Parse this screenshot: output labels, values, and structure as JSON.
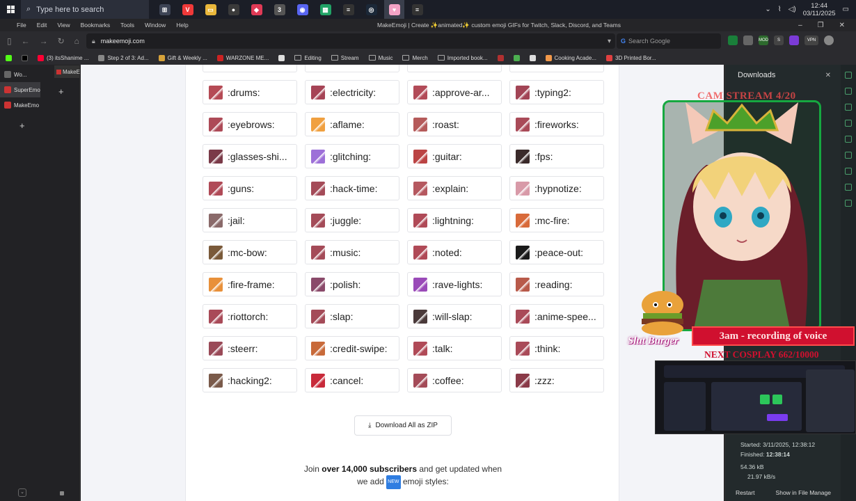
{
  "taskbar": {
    "search_placeholder": "Type here to search",
    "clock_time": "12:44",
    "clock_date": "03/11/2025",
    "apps": [
      {
        "icon": "widgets-icon",
        "color": "#3d4455",
        "glyph": "⊞"
      },
      {
        "icon": "vivaldi-icon",
        "color": "#ef3939",
        "glyph": "V"
      },
      {
        "icon": "folder-icon",
        "color": "#e9b73b",
        "glyph": "▭"
      },
      {
        "icon": "obs-icon",
        "color": "#3a3a3a",
        "glyph": "●"
      },
      {
        "icon": "maps-pin-icon",
        "color": "#e03a56",
        "glyph": "◆"
      },
      {
        "icon": "app3-icon",
        "color": "#555",
        "glyph": "3"
      },
      {
        "icon": "discord-icon",
        "color": "#5865f2",
        "glyph": "◉"
      },
      {
        "icon": "sheets-icon",
        "color": "#21a366",
        "glyph": "▦"
      },
      {
        "icon": "streamdeck-icon",
        "color": "#333",
        "glyph": "≡"
      },
      {
        "icon": "steam-icon",
        "color": "#1b2838",
        "glyph": "◎"
      },
      {
        "icon": "heart-app-icon",
        "color": "#f4a3c6",
        "glyph": "♥"
      },
      {
        "icon": "streamdeck2-icon",
        "color": "#333",
        "glyph": "≡"
      }
    ]
  },
  "browser": {
    "menu": [
      "File",
      "Edit",
      "View",
      "Bookmarks",
      "Tools",
      "Window",
      "Help"
    ],
    "title": "MakeEmoji | Create ✨animated✨ custom emoji GIFs for Twitch, Slack, Discord, and Teams",
    "url": "makeemoji.com",
    "search_placeholder": "Search Google",
    "bookmarks": [
      {
        "label": "(3) itsShanime ...",
        "color": "#ff0033"
      },
      {
        "label": "Step 2 of 3: Ad...",
        "color": "#888"
      },
      {
        "label": "Gift & Weekly ...",
        "color": "#d6a23a"
      },
      {
        "label": "WARZONE ME...",
        "color": "#c22"
      },
      {
        "label": "",
        "color": "#ddd"
      },
      {
        "label": "Editing",
        "color": "folder"
      },
      {
        "label": "Stream",
        "color": "folder"
      },
      {
        "label": "Music",
        "color": "folder"
      },
      {
        "label": "Merch",
        "color": "folder"
      },
      {
        "label": "Imported book...",
        "color": "folder"
      },
      {
        "label": "",
        "color": "#b03030"
      },
      {
        "label": "",
        "color": "#4caf50"
      },
      {
        "label": "",
        "color": "#ddd"
      },
      {
        "label": "Cooking Acade...",
        "color": "#f2994a"
      },
      {
        "label": "3D Printed Bor...",
        "color": "#e04040"
      }
    ]
  },
  "left_panel": {
    "tabs": [
      {
        "label": "Wo...",
        "color": "#666"
      },
      {
        "label": "SuperEmo",
        "color": "#c33"
      },
      {
        "label": "MakeEmo",
        "color": "#c33"
      }
    ],
    "pinned_tab": "MakeE"
  },
  "emojis": [
    {
      "name": ":drums:",
      "color": "#b54a55"
    },
    {
      "name": ":electricity:",
      "color": "#a64456"
    },
    {
      "name": ":approve-ar...",
      "color": "#b24b58"
    },
    {
      "name": ":typing2:",
      "color": "#a24455"
    },
    {
      "name": ":eyebrows:",
      "color": "#ad4a57"
    },
    {
      "name": ":aflame:",
      "color": "#f0a040"
    },
    {
      "name": ":roast:",
      "color": "#b55a5a"
    },
    {
      "name": ":fireworks:",
      "color": "#a94a58"
    },
    {
      "name": ":glasses-shi...",
      "color": "#7a3a48"
    },
    {
      "name": ":glitching:",
      "color": "#9d70d8"
    },
    {
      "name": ":guitar:",
      "color": "#b44"
    },
    {
      "name": ":fps:",
      "color": "#3a2a2a"
    },
    {
      "name": ":guns:",
      "color": "#b04a57"
    },
    {
      "name": ":hack-time:",
      "color": "#a44b58"
    },
    {
      "name": ":explain:",
      "color": "#b5585f"
    },
    {
      "name": ":hypnotize:",
      "color": "#d89aa8"
    },
    {
      "name": ":jail:",
      "color": "#8a6a6a"
    },
    {
      "name": ":juggle:",
      "color": "#a44b58"
    },
    {
      "name": ":lightning:",
      "color": "#b04a57"
    },
    {
      "name": ":mc-fire:",
      "color": "#d86a3a"
    },
    {
      "name": ":mc-bow:",
      "color": "#7a5a3a"
    },
    {
      "name": ":music:",
      "color": "#a44b58"
    },
    {
      "name": ":noted:",
      "color": "#b04a57"
    },
    {
      "name": ":peace-out:",
      "color": "#1a1a1a"
    },
    {
      "name": ":fire-frame:",
      "color": "#e8903a"
    },
    {
      "name": ":polish:",
      "color": "#8a4a6a"
    },
    {
      "name": ":rave-lights:",
      "color": "#9a4ab8"
    },
    {
      "name": ":reading:",
      "color": "#b85a4a"
    },
    {
      "name": ":riottorch:",
      "color": "#a94a58"
    },
    {
      "name": ":slap:",
      "color": "#a44b58"
    },
    {
      "name": ":will-slap:",
      "color": "#4a3a3a"
    },
    {
      "name": ":anime-spee...",
      "color": "#a94a58"
    },
    {
      "name": ":steerr:",
      "color": "#9a4a58"
    },
    {
      "name": ":credit-swipe:",
      "color": "#c86a3a"
    },
    {
      "name": ":talk:",
      "color": "#b04a57"
    },
    {
      "name": ":think:",
      "color": "#a94a58"
    },
    {
      "name": ":hacking2:",
      "color": "#7a5a4a"
    },
    {
      "name": ":cancel:",
      "color": "#c82a3a"
    },
    {
      "name": ":coffee:",
      "color": "#a44b58"
    },
    {
      "name": ":zzz:",
      "color": "#8a3a48"
    }
  ],
  "download_zip": {
    "label": "Download All as ZIP"
  },
  "join": {
    "prefix": "Join ",
    "bold": "over 14,000 subscribers",
    "suffix": " and get updated when",
    "line2_prefix": "we add ",
    "badge": "NEW",
    "line2_suffix": " emoji styles:"
  },
  "downloads": {
    "title": "Downloads",
    "started": "Started:  3/11/2025, 12:38:12",
    "finished_label": "Finished: ",
    "finished_time": "12:38:14",
    "size": "54.36 kB",
    "speed": "21.97 kB/s",
    "restart": "Restart",
    "show_in_file_manager": "Show in File Manage"
  },
  "overlay": {
    "cam_title": "CAM STREAM 4/20",
    "recording_banner": "3am - recording of voice",
    "cosplay_goal": "NEXT COSPLAY 662/10000",
    "logo": "Slut Burger"
  }
}
